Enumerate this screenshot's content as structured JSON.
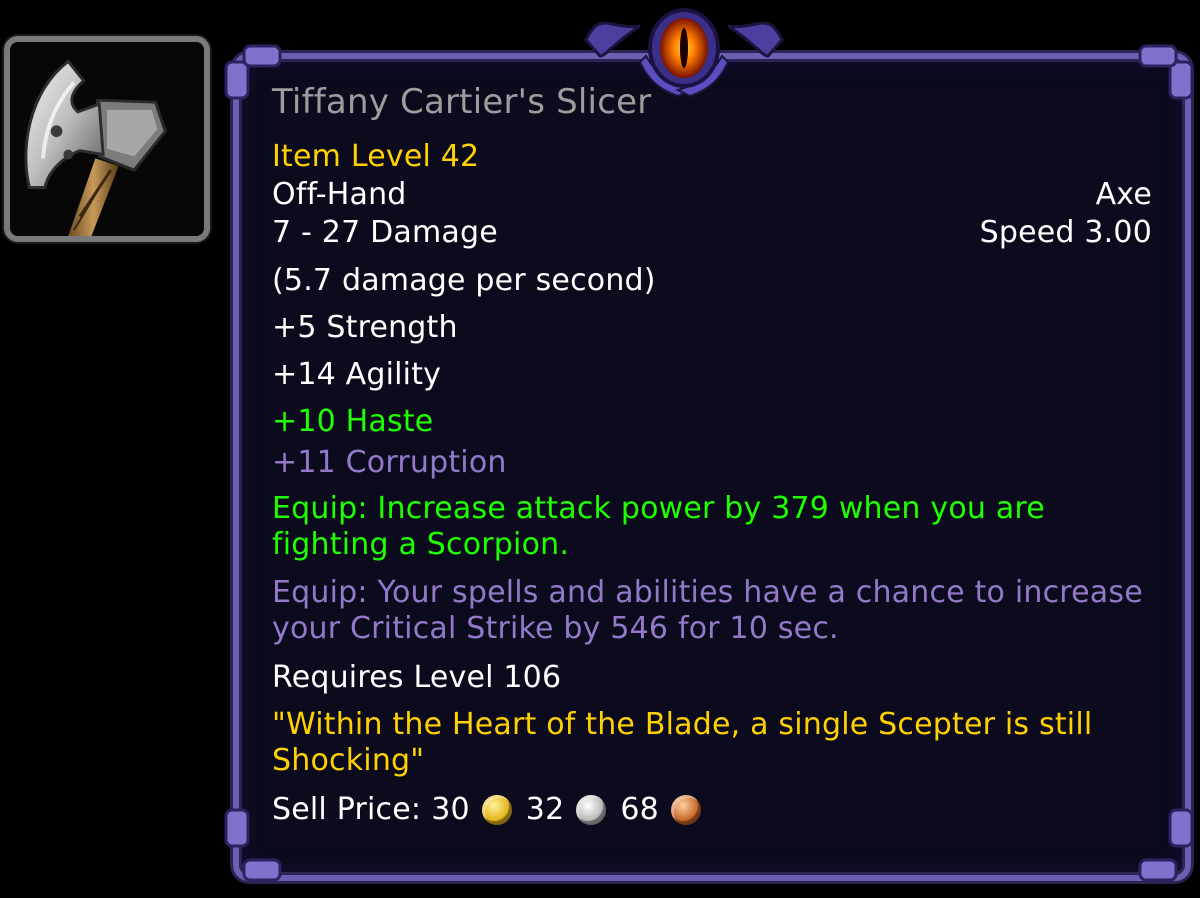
{
  "item": {
    "name": "Tiffany Cartier's Slicer",
    "item_level": "Item Level 42",
    "slot": "Off-Hand",
    "type": "Axe",
    "damage": "7 - 27 Damage",
    "speed": "Speed 3.00",
    "dps": "(5.7 damage per second)",
    "stats": {
      "strength": "+5 Strength",
      "agility": "+14 Agility",
      "haste": "+10 Haste",
      "corruption": "+11 Corruption"
    },
    "equip_1": "Equip: Increase attack power by 379 when you are fighting a Scorpion.",
    "equip_2": "Equip: Your spells and abilities have a chance to increase your Critical Strike by 546 for 10 sec.",
    "requires": "Requires Level 106",
    "flavor": "\"Within the Heart of the Blade, a single Scepter is still Shocking\"",
    "sell": {
      "label": "Sell Price:",
      "gold": "30",
      "silver": "32",
      "copper": "68"
    }
  },
  "icons": {
    "item_icon": "axe-icon",
    "frame_ornament": "eye-icon",
    "gold": "gold-coin-icon",
    "silver": "silver-coin-icon",
    "copper": "copper-coin-icon"
  },
  "colors": {
    "title": "#9d9d9d",
    "item_level": "#ffd100",
    "normal": "#ffffff",
    "bonus": "#1eff00",
    "corruption": "#9479c9",
    "flavor": "#ffd100",
    "frame": "#6a5fb0"
  }
}
